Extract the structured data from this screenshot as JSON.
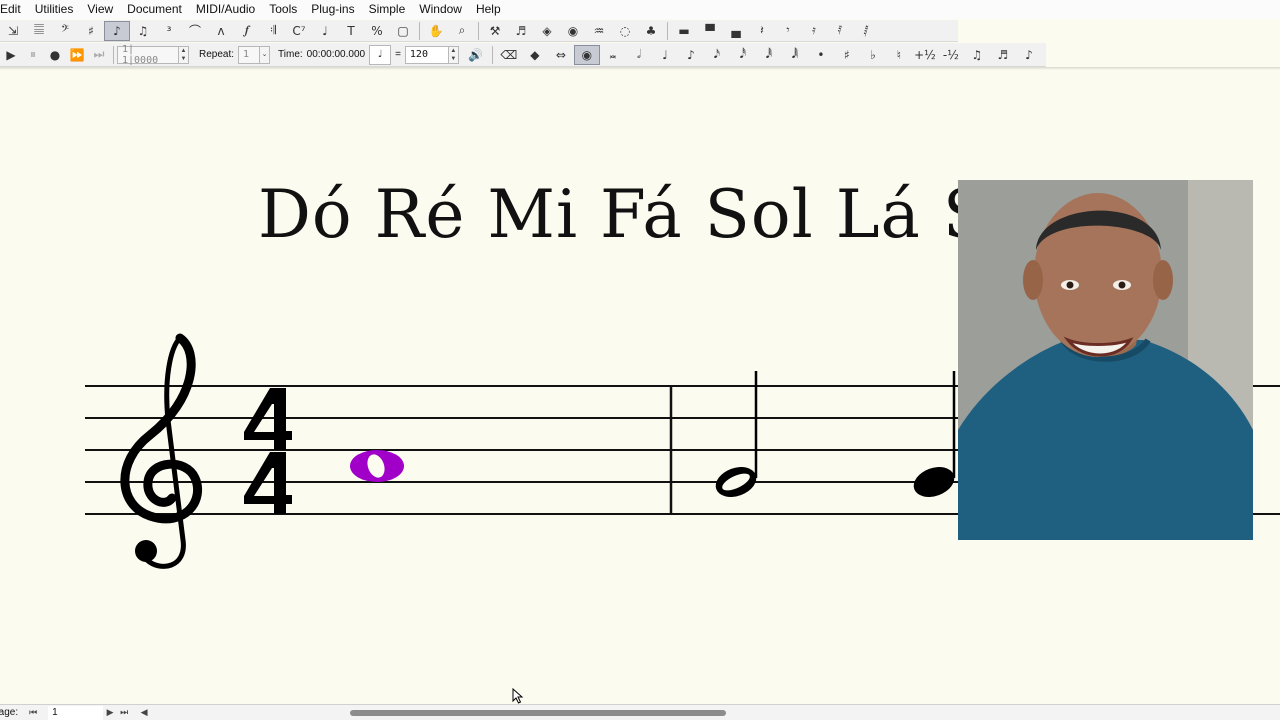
{
  "menu": [
    "Edit",
    "Utilities",
    "View",
    "Document",
    "MIDI/Audio",
    "Tools",
    "Plug-ins",
    "Simple",
    "Window",
    "Help"
  ],
  "toolbar1": {
    "tools": [
      {
        "name": "selection-tool-icon",
        "glyph": "⇲"
      },
      {
        "name": "staff-tool-icon",
        "glyph": "𝄚"
      },
      {
        "name": "clef-tool-icon",
        "glyph": "𝄢"
      },
      {
        "name": "key-signature-tool-icon",
        "glyph": "♯"
      },
      {
        "name": "simple-entry-tool-icon",
        "glyph": "♪"
      },
      {
        "name": "speedy-entry-tool-icon",
        "glyph": "♫"
      },
      {
        "name": "tuplet-tool-icon",
        "glyph": "³"
      },
      {
        "name": "smart-shape-tool-icon",
        "glyph": "⌒"
      },
      {
        "name": "articulation-tool-icon",
        "glyph": "ʌ"
      },
      {
        "name": "expression-tool-icon",
        "glyph": "𝆑"
      },
      {
        "name": "repeat-tool-icon",
        "glyph": "𝄇"
      },
      {
        "name": "chord-tool-icon",
        "glyph": "C⁷"
      },
      {
        "name": "lyrics-tool-icon",
        "glyph": "♩"
      },
      {
        "name": "text-tool-icon",
        "glyph": "T"
      },
      {
        "name": "resize-tool-icon",
        "glyph": "%"
      },
      {
        "name": "page-layout-tool-icon",
        "glyph": "▢"
      },
      {
        "name": "hand-grabber-tool-icon",
        "glyph": "✋"
      },
      {
        "name": "zoom-tool-icon",
        "glyph": "⌕"
      },
      {
        "name": "special-tools-icon",
        "glyph": "⚒"
      },
      {
        "name": "ossia-tool-icon",
        "glyph": "♬"
      },
      {
        "name": "graphics-tool-icon",
        "glyph": "◈"
      },
      {
        "name": "midi-tool-icon",
        "glyph": "◉"
      },
      {
        "name": "mirror-tool-icon",
        "glyph": "♒"
      },
      {
        "name": "note-mover-tool-icon",
        "glyph": "◌"
      },
      {
        "name": "measure-tool-icon",
        "glyph": "♣"
      },
      {
        "name": "double-whole-rest-icon",
        "glyph": "▬"
      },
      {
        "name": "whole-rest-icon",
        "glyph": "▀"
      },
      {
        "name": "half-rest-icon",
        "glyph": "▄"
      },
      {
        "name": "quarter-rest-icon",
        "glyph": "𝄽"
      },
      {
        "name": "eighth-rest-icon",
        "glyph": "𝄾"
      },
      {
        "name": "sixteenth-rest-icon",
        "glyph": "𝄿"
      },
      {
        "name": "thirty-second-rest-icon",
        "glyph": "𝅀"
      },
      {
        "name": "sixty-fourth-rest-icon",
        "glyph": "𝅁"
      }
    ]
  },
  "playback": {
    "counter": "1| 1|0000",
    "repeat_label": "Repeat:",
    "repeat_value": "1",
    "time_label": "Time:",
    "time_value": "00:00:00.000",
    "equals": "=",
    "tempo": "120"
  },
  "toolbar2": {
    "tools": [
      {
        "name": "eraser-tool-icon",
        "glyph": "⌫"
      },
      {
        "name": "tie-tool-icon",
        "glyph": "◆"
      },
      {
        "name": "grace-note-tool-icon",
        "glyph": "⇔"
      },
      {
        "name": "playback-eye-icon",
        "glyph": "◉"
      },
      {
        "name": "double-whole-note-icon",
        "glyph": "𝅜"
      },
      {
        "name": "half-note-icon",
        "glyph": "𝅗𝅥"
      },
      {
        "name": "quarter-note-icon",
        "glyph": "♩"
      },
      {
        "name": "eighth-note-icon",
        "glyph": "♪"
      },
      {
        "name": "sixteenth-note-icon",
        "glyph": "𝅘𝅥𝅯"
      },
      {
        "name": "thirty-second-note-icon",
        "glyph": "𝅘𝅥𝅰"
      },
      {
        "name": "sixty-fourth-note-icon",
        "glyph": "𝅘𝅥𝅱"
      },
      {
        "name": "hundred-twenty-eighth-note-icon",
        "glyph": "𝅘𝅥𝅲"
      },
      {
        "name": "dot-icon",
        "glyph": "•"
      },
      {
        "name": "sharp-icon",
        "glyph": "♯"
      },
      {
        "name": "flat-icon",
        "glyph": "♭"
      },
      {
        "name": "natural-icon",
        "glyph": "♮"
      },
      {
        "name": "half-step-up-icon",
        "glyph": "+½"
      },
      {
        "name": "half-step-down-icon",
        "glyph": "-½"
      },
      {
        "name": "flip-stem-icon",
        "glyph": "♫"
      },
      {
        "name": "beam-icon",
        "glyph": "♬"
      },
      {
        "name": "grace-eighth-icon",
        "glyph": "♪"
      }
    ]
  },
  "score": {
    "title": "Dó Ré Mi Fá Sol Lá Si",
    "colors": {
      "ink": "#000000",
      "selected_note": "#a000c8",
      "background": "#fcfbf0"
    }
  },
  "status": {
    "page_label": "Page:",
    "page_value": "1"
  }
}
